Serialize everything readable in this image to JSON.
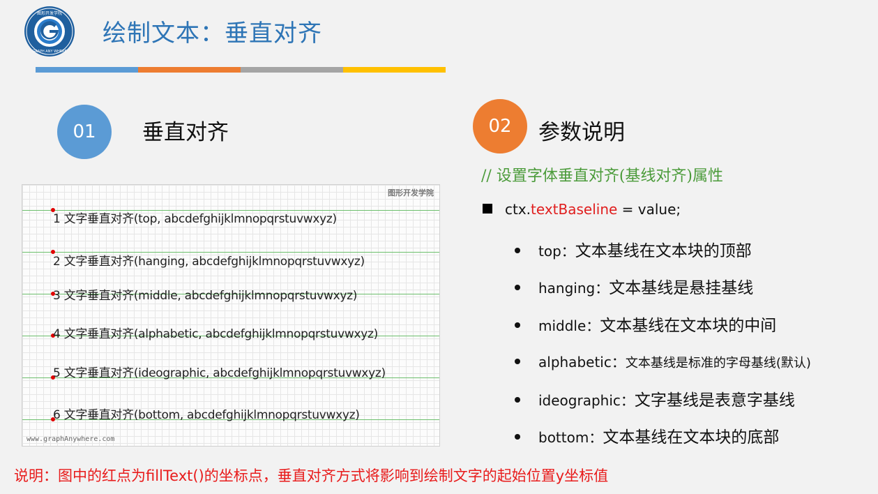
{
  "header": {
    "title": "绘制文本：垂直对齐",
    "bar_colors": [
      "#5b9bd5",
      "#ed7d31",
      "#a5a5a5",
      "#ffc000"
    ]
  },
  "logo": {
    "icon": "graph-anywhere-logo",
    "top_text": "图形开发学院",
    "bottom_text": "GRAPH ANY WHERE",
    "letter": "G"
  },
  "section1": {
    "number": "01",
    "heading": "垂直对齐",
    "color": "#5b9bd5"
  },
  "section2": {
    "number": "02",
    "heading": "参数说明",
    "color": "#ed7d31"
  },
  "demo": {
    "watermark": "图形开发学院",
    "footer": "www.graphAnywhere.com",
    "rows": [
      "1 文字垂直对齐(top, abcdefghijklmnopqrstuvwxyz)",
      "2 文字垂直对齐(hanging, abcdefghijklmnopqrstuvwxyz)",
      "3 文字垂直对齐(middle, abcdefghijklmnopqrstuvwxyz)",
      "4 文字垂直对齐(alphabetic, abcdefghijklmnopqrstuvwxyz)",
      "5 文字垂直对齐(ideographic, abcdefghijklmnopqrstuvwxyz)",
      "6 文字垂直对齐(bottom, abcdefghijklmnopqrstuvwxyz)"
    ]
  },
  "params": {
    "comment": "// 设置字体垂直对齐(基线对齐)属性",
    "code_prefix": "ctx.",
    "code_prop": "textBaseline",
    "code_suffix": " = value;",
    "items": [
      {
        "key": "top：",
        "desc": "文本基线在文本块的顶部"
      },
      {
        "key": "hanging：",
        "desc": "文本基线是悬挂基线"
      },
      {
        "key": "middle：",
        "desc": "文本基线在文本块的中间"
      },
      {
        "key": "alphabetic：",
        "desc": "文本基线是标准的字母基线(默认)"
      },
      {
        "key": "ideographic：",
        "desc": "文字基线是表意字基线"
      },
      {
        "key": "bottom：",
        "desc": "文本基线在文本块的底部"
      }
    ]
  },
  "note": "说明：图中的红点为fillText()的坐标点，垂直对齐方式将影响到绘制文字的起始位置y坐标值"
}
